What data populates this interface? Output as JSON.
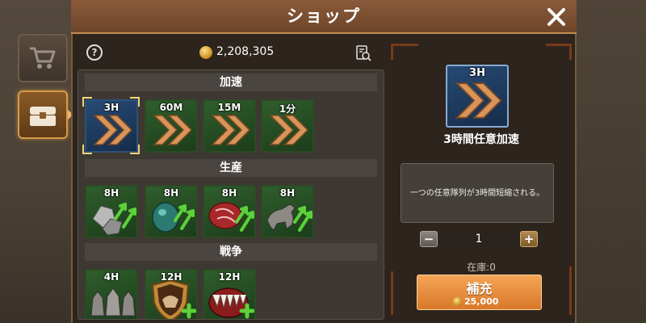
{
  "header": {
    "title": "ショップ"
  },
  "topbar": {
    "coins": "2,208,305"
  },
  "sections": [
    {
      "title": "加速",
      "items": [
        {
          "label": "3H",
          "kind": "speed",
          "selected": true
        },
        {
          "label": "60M",
          "kind": "speed"
        },
        {
          "label": "15M",
          "kind": "speed"
        },
        {
          "label": "1分",
          "kind": "speed"
        }
      ]
    },
    {
      "title": "生産",
      "items": [
        {
          "label": "8H",
          "kind": "stone"
        },
        {
          "label": "8H",
          "kind": "ore"
        },
        {
          "label": "8H",
          "kind": "meat"
        },
        {
          "label": "8H",
          "kind": "wolf"
        }
      ]
    },
    {
      "title": "戦争",
      "items": [
        {
          "label": "4H",
          "kind": "wolves"
        },
        {
          "label": "12H",
          "kind": "shield"
        },
        {
          "label": "12H",
          "kind": "fangs"
        }
      ]
    }
  ],
  "detail": {
    "icon_label": "3H",
    "name": "3時間任意加速",
    "description": "一つの任意隊列が3時間短縮される。",
    "quantity": "1",
    "stock": "在庫:0",
    "refill_label": "補充",
    "refill_price": "25,000"
  },
  "colors": {
    "accent": "#d8782a",
    "header": "#7a4a2c",
    "selected_item": "#274a73",
    "item_green": "#2f5e2c"
  }
}
